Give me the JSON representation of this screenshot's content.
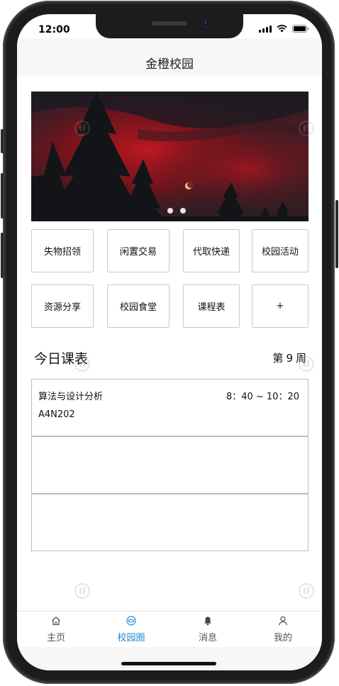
{
  "status_bar": {
    "time": "12:00"
  },
  "header": {
    "title": "金橙校园"
  },
  "banner": {
    "page_count": 2,
    "active_index": 0
  },
  "quick_actions": [
    {
      "label": "失物招领"
    },
    {
      "label": "闲置交易"
    },
    {
      "label": "代取快递"
    },
    {
      "label": "校园活动"
    },
    {
      "label": "资源分享"
    },
    {
      "label": "校园食堂"
    },
    {
      "label": "课程表"
    },
    {
      "label": "+"
    }
  ],
  "schedule": {
    "title": "今日课表",
    "week_prefix": "第",
    "week_number": "9",
    "week_suffix": "周",
    "courses": [
      {
        "name": "算法与设计分析",
        "time": "8：40 ~ 10：20",
        "room": "A4N202"
      },
      {
        "name": "",
        "time": "",
        "room": ""
      },
      {
        "name": "",
        "time": "",
        "room": ""
      }
    ]
  },
  "tab_bar": {
    "tabs": [
      {
        "label": "主页",
        "icon": "home-icon"
      },
      {
        "label": "校园圈",
        "icon": "campus-circle-icon",
        "active": true
      },
      {
        "label": "消息",
        "icon": "bell-icon"
      },
      {
        "label": "我的",
        "icon": "user-icon"
      }
    ],
    "active_color": "#1e88d6"
  }
}
